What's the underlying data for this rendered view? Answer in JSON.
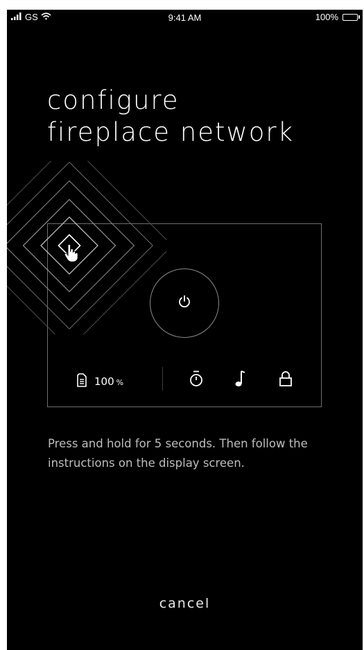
{
  "status_bar": {
    "carrier": "GS",
    "time": "9:41 AM",
    "battery_percent": "100%",
    "battery_level": 1.0
  },
  "title": {
    "line1": "configure",
    "line2": "fireplace network"
  },
  "control_panel": {
    "wood_level_value": "100",
    "wood_level_unit": "%",
    "icons": [
      "power-icon",
      "wood-container-icon",
      "timer-icon",
      "music-note-icon",
      "lock-icon",
      "pressing-hand-icon"
    ]
  },
  "instructions": "Press and hold for 5 seconds. Then follow the instructions on the display screen.",
  "cancel_label": "cancel",
  "colors": {
    "background": "#000000",
    "text": "#ffffff",
    "instruction_text": "#bdbdbd",
    "lines": "#8a8a8a"
  }
}
